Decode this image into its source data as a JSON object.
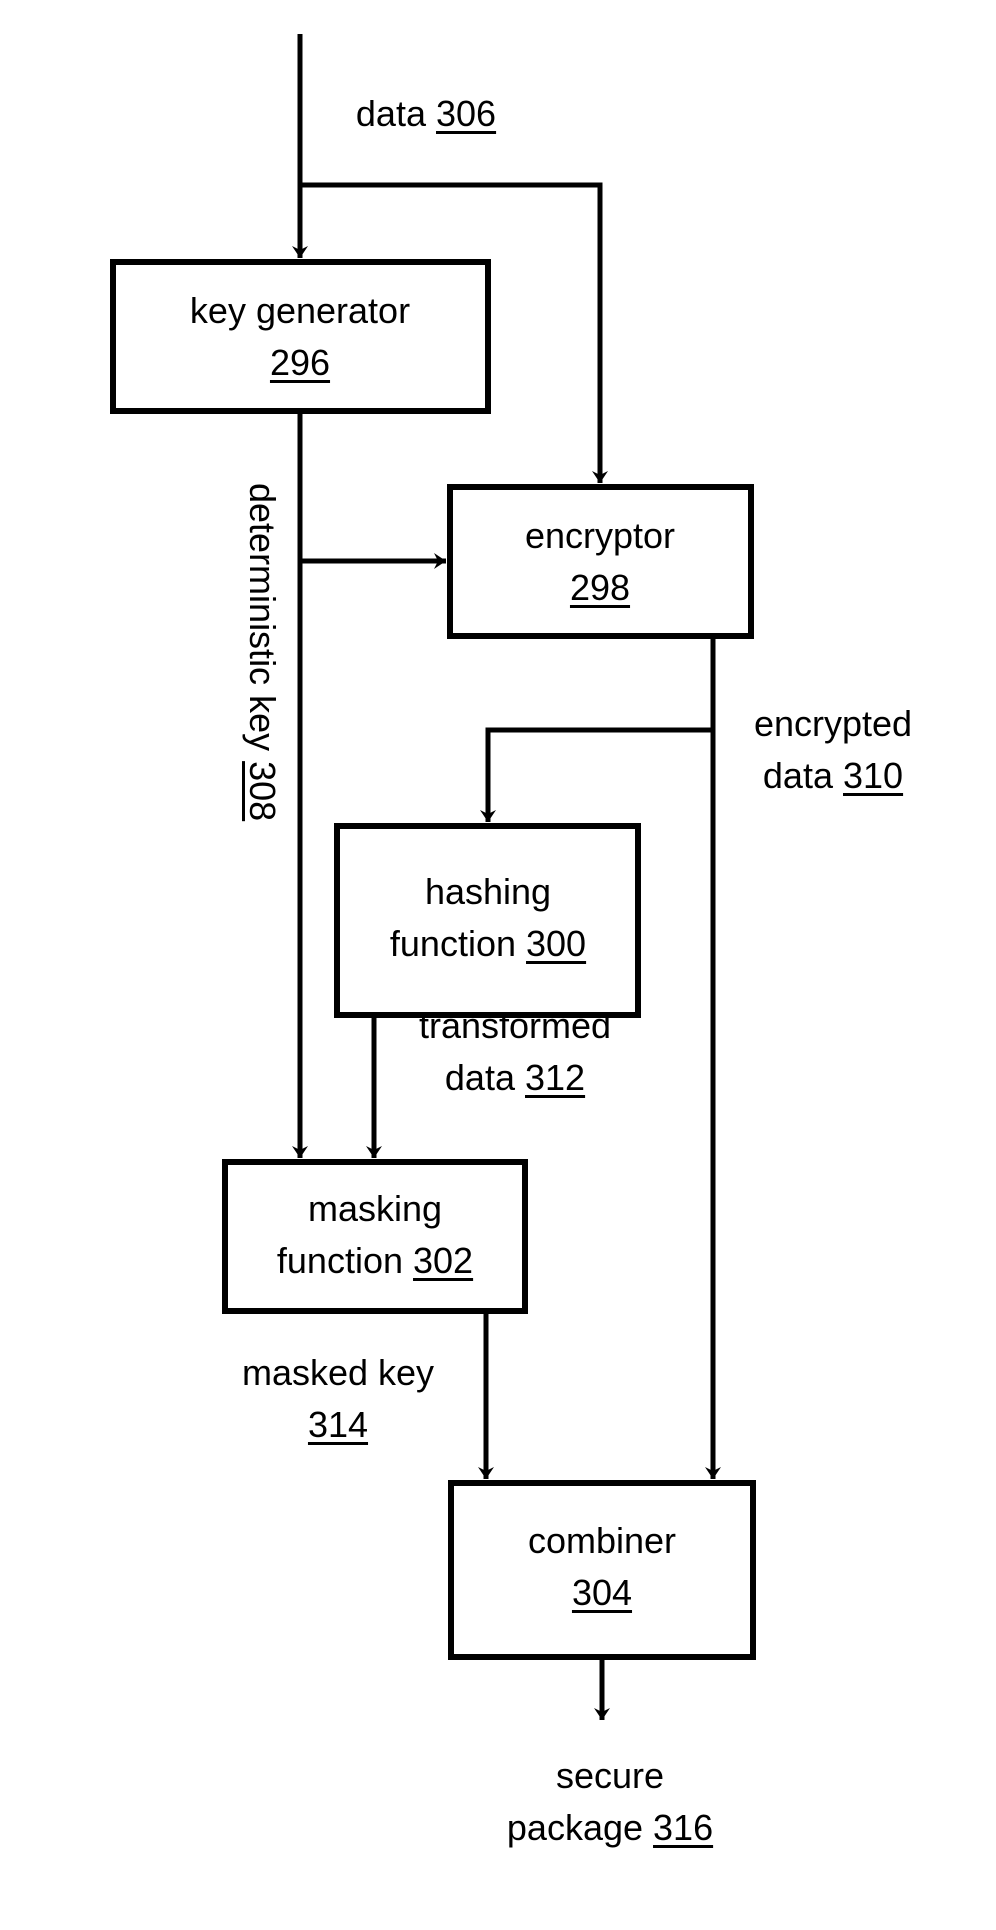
{
  "diagram": {
    "nodes": [
      {
        "id": "key-generator",
        "label": "key generator",
        "ref": "296"
      },
      {
        "id": "encryptor",
        "label": "encryptor",
        "ref": "298"
      },
      {
        "id": "hashing-function",
        "label": "hashing function",
        "ref": "300"
      },
      {
        "id": "masking-function",
        "label": "masking function",
        "ref": "302"
      },
      {
        "id": "combiner",
        "label": "combiner",
        "ref": "304"
      }
    ],
    "edges": [
      {
        "id": "data",
        "label": "data",
        "ref": "306",
        "from": "input",
        "to": [
          "key-generator",
          "encryptor"
        ]
      },
      {
        "id": "deterministic-key",
        "label": "deterministic key",
        "ref": "308",
        "from": "key-generator",
        "to": [
          "encryptor",
          "masking-function"
        ]
      },
      {
        "id": "encrypted-data",
        "label": "encrypted data",
        "ref": "310",
        "from": "encryptor",
        "to": [
          "hashing-function",
          "combiner"
        ]
      },
      {
        "id": "transformed-data",
        "label": "transformed data",
        "ref": "312",
        "from": "hashing-function",
        "to": [
          "masking-function"
        ]
      },
      {
        "id": "masked-key",
        "label": "masked key",
        "ref": "314",
        "from": "masking-function",
        "to": [
          "combiner"
        ]
      },
      {
        "id": "secure-package",
        "label": "secure package",
        "ref": "316",
        "from": "combiner",
        "to": [
          "output"
        ]
      }
    ]
  },
  "labels": {
    "data": {
      "text": "data",
      "ref": "306"
    },
    "key_generator": {
      "line1": "key generator",
      "ref": "296"
    },
    "encryptor": {
      "line1": "encryptor",
      "ref": "298"
    },
    "deterministic_key": {
      "text": "deterministic key",
      "ref": "308"
    },
    "encrypted_data": {
      "line1": "encrypted",
      "line2": "data",
      "ref": "310"
    },
    "hashing_function": {
      "line1": "hashing",
      "line2": "function",
      "ref": "300"
    },
    "transformed_data": {
      "line1": "transformed",
      "line2": "data",
      "ref": "312"
    },
    "masking_function": {
      "line1": "masking",
      "line2": "function",
      "ref": "302"
    },
    "masked_key": {
      "line1": "masked key",
      "ref": "314"
    },
    "combiner": {
      "line1": "combiner",
      "ref": "304"
    },
    "secure_package": {
      "line1": "secure",
      "line2": "package",
      "ref": "316"
    }
  }
}
